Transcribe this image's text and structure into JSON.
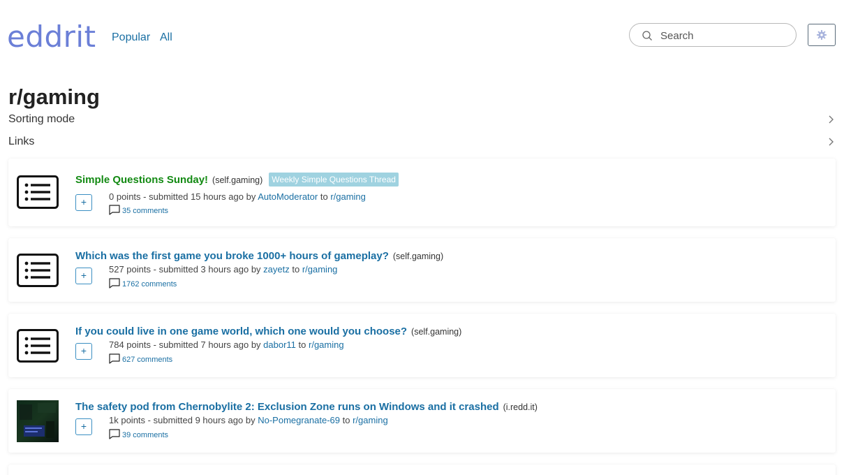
{
  "header": {
    "logo": "eddrit",
    "nav": [
      "Popular",
      "All"
    ],
    "search_placeholder": "Search"
  },
  "subreddit": {
    "title": "r/gaming",
    "sorting_label": "Sorting mode",
    "links_label": "Links"
  },
  "posts": [
    {
      "title": "Simple Questions Sunday!",
      "domain": "(self.gaming)",
      "flair": "Weekly Simple Questions Thread",
      "points": "0 points",
      "submitted": "submitted 15 hours ago",
      "author": "AutoModerator",
      "subreddit": "r/gaming",
      "comments": "35 comments",
      "expand": "+"
    },
    {
      "title": "Which was the first game you broke 1000+ hours of gameplay?",
      "domain": "(self.gaming)",
      "points": "527 points",
      "submitted": "submitted 3 hours ago",
      "author": "zayetz",
      "subreddit": "r/gaming",
      "comments": "1762 comments",
      "expand": "+"
    },
    {
      "title": "If you could live in one game world, which one would you choose?",
      "domain": "(self.gaming)",
      "points": "784 points",
      "submitted": "submitted 7 hours ago",
      "author": "dabor11",
      "subreddit": "r/gaming",
      "comments": "627 comments",
      "expand": "+"
    },
    {
      "title": "The safety pod from Chernobylite 2: Exclusion Zone runs on Windows and it crashed",
      "domain": "(i.redd.it)",
      "points": "1k points",
      "submitted": "submitted 9 hours ago",
      "author": "No-Pomegranate-69",
      "subreddit": "r/gaming",
      "comments": "39 comments",
      "expand": "+"
    }
  ],
  "text_glue": {
    "dash": " - ",
    "by": " by ",
    "to": " to "
  },
  "colors": {
    "link": "#1a6fa3",
    "mod_title": "#138a13",
    "logo": "#6b7fd7",
    "flair_bg": "#9fd2e0"
  },
  "icons": {
    "search": "search-icon",
    "settings": "gear-icon",
    "self_post": "text-lines-icon",
    "comment": "comment-bubble-icon",
    "chevron": "chevron-right-icon"
  }
}
